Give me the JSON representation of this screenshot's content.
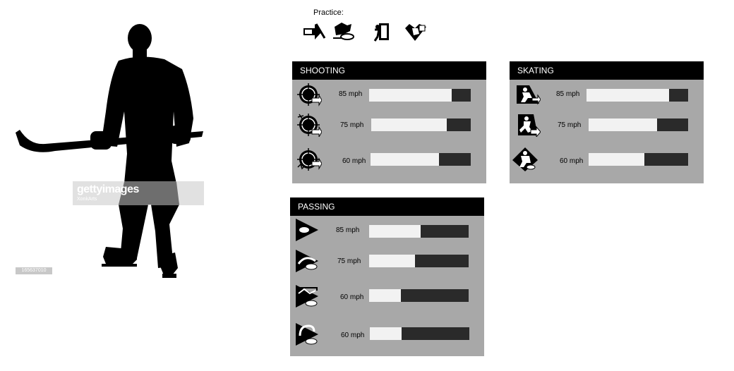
{
  "watermark": {
    "brand": "gettyimages",
    "author": "XonkArts",
    "image_id": "165637010"
  },
  "practice": {
    "label": "Practice:",
    "icons": [
      "shooting-practice-icon",
      "skating-practice-icon",
      "exit-door-icon",
      "passing-practice-icon"
    ]
  },
  "panels": [
    {
      "id": "shooting",
      "title": "SHOOTING",
      "rows": [
        {
          "icon": "crosshair-shooter-icon",
          "speed": "85 mph",
          "level": 0.81
        },
        {
          "icon": "crosshair-slapshot-icon",
          "speed": "75 mph",
          "level": 0.76
        },
        {
          "icon": "crosshair-puck-icon",
          "speed": "60 mph",
          "level": 0.68
        }
      ]
    },
    {
      "id": "skating",
      "title": "SKATING",
      "rows": [
        {
          "icon": "skater-forward-icon",
          "speed": "85 mph",
          "level": 0.81
        },
        {
          "icon": "skater-crossover-icon",
          "speed": "75 mph",
          "level": 0.69
        },
        {
          "icon": "skater-stop-icon",
          "speed": "60 mph",
          "level": 0.56
        }
      ]
    },
    {
      "id": "passing",
      "title": "PASSING",
      "rows": [
        {
          "icon": "pass-forward-icon",
          "speed": "85 mph",
          "level": 0.52
        },
        {
          "icon": "pass-curve-icon",
          "speed": "75 mph",
          "level": 0.46
        },
        {
          "icon": "pass-saucer-icon",
          "speed": "60 mph",
          "level": 0.32
        },
        {
          "icon": "pass-backhand-icon",
          "speed": "60 mph",
          "level": 0.32
        }
      ]
    }
  ]
}
